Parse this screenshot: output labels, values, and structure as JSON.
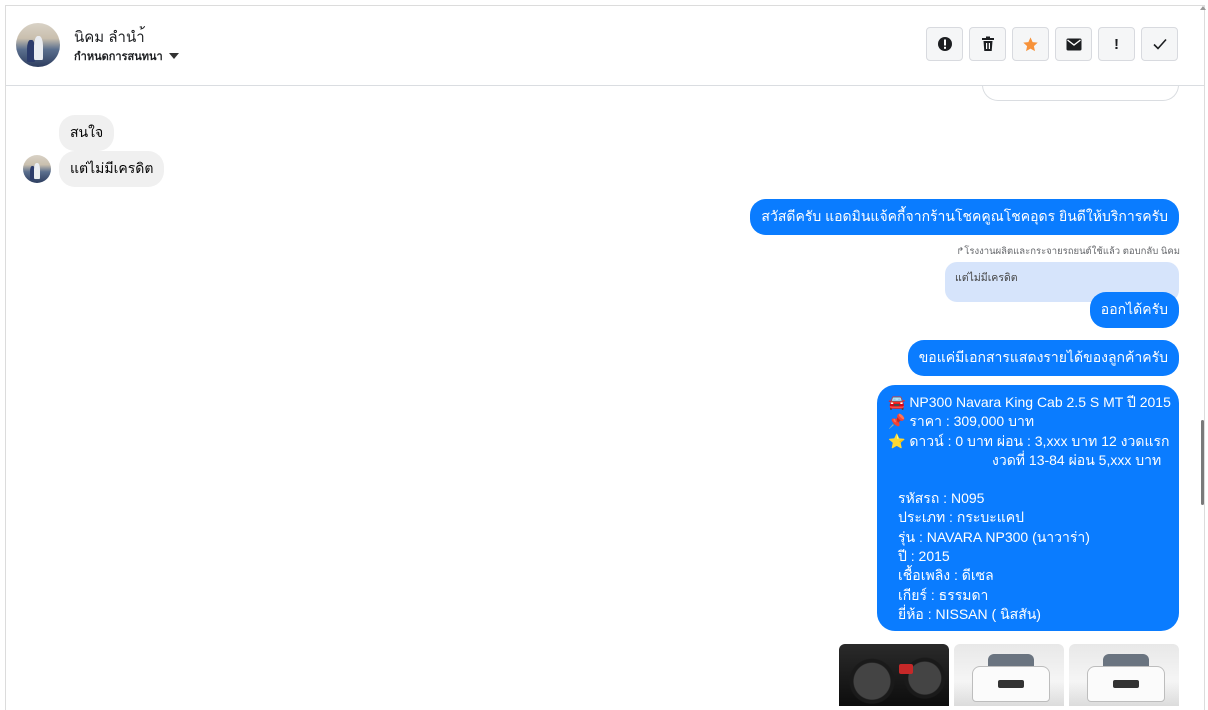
{
  "header": {
    "name": "นิคม ลำนำ้",
    "subtitle": "กำหนดการสนทนา",
    "actions": [
      "warning-icon",
      "trash-icon",
      "star-icon",
      "mail-icon",
      "exclamation-icon",
      "check-icon"
    ],
    "exclamation_label": "!",
    "star_color": "#f7923a"
  },
  "thread": {
    "incoming": [
      "สนใจ",
      "แต่ไม่มีเครดิต"
    ],
    "out_greeting": "สวัสดีครับ แอดมินแจ้คกี้จากร้านโชคคูณโชคอุดร ยินดีให้บริการครับ",
    "reply_meta": "↱โรงงานผลิตและกระจายรถยนต์ใช้แล้ว ตอบกลับ นิคม",
    "quoted_text": "แต่ไม่มีเครดิต",
    "out_reply": "ออกได้ครับ",
    "out_docs": "ขอแค่มีเอกสารแสดงรายได้ของลูกค้าครับ",
    "card": {
      "line1": "🚘 NP300 Navara King Cab 2.5 S MT ปี 2015",
      "line2": "📌 ราคา : 309,000 บาท",
      "line3": "⭐ ดาวน์ : 0 บาท ผ่อน : 3,xxx บาท 12 งวดแรก",
      "line4": "งวดที่ 13-84 ผ่อน 5,xxx บาท",
      "details": [
        "รหัสรถ : N095",
        "ประเภท : กระบะแคป",
        "รุ่น : NAVARA NP300 (นาวาร่า)",
        "ปี : 2015",
        "เชื้อเพลิง : ดีเซล",
        "เกียร์ : ธรรมดา",
        "ยี่ห้อ : NISSAN ( นิสสัน)"
      ]
    }
  },
  "colors": {
    "outgoing": "#0a7cff",
    "incoming": "#f0f0f0",
    "quote": "#d6e4fb"
  }
}
